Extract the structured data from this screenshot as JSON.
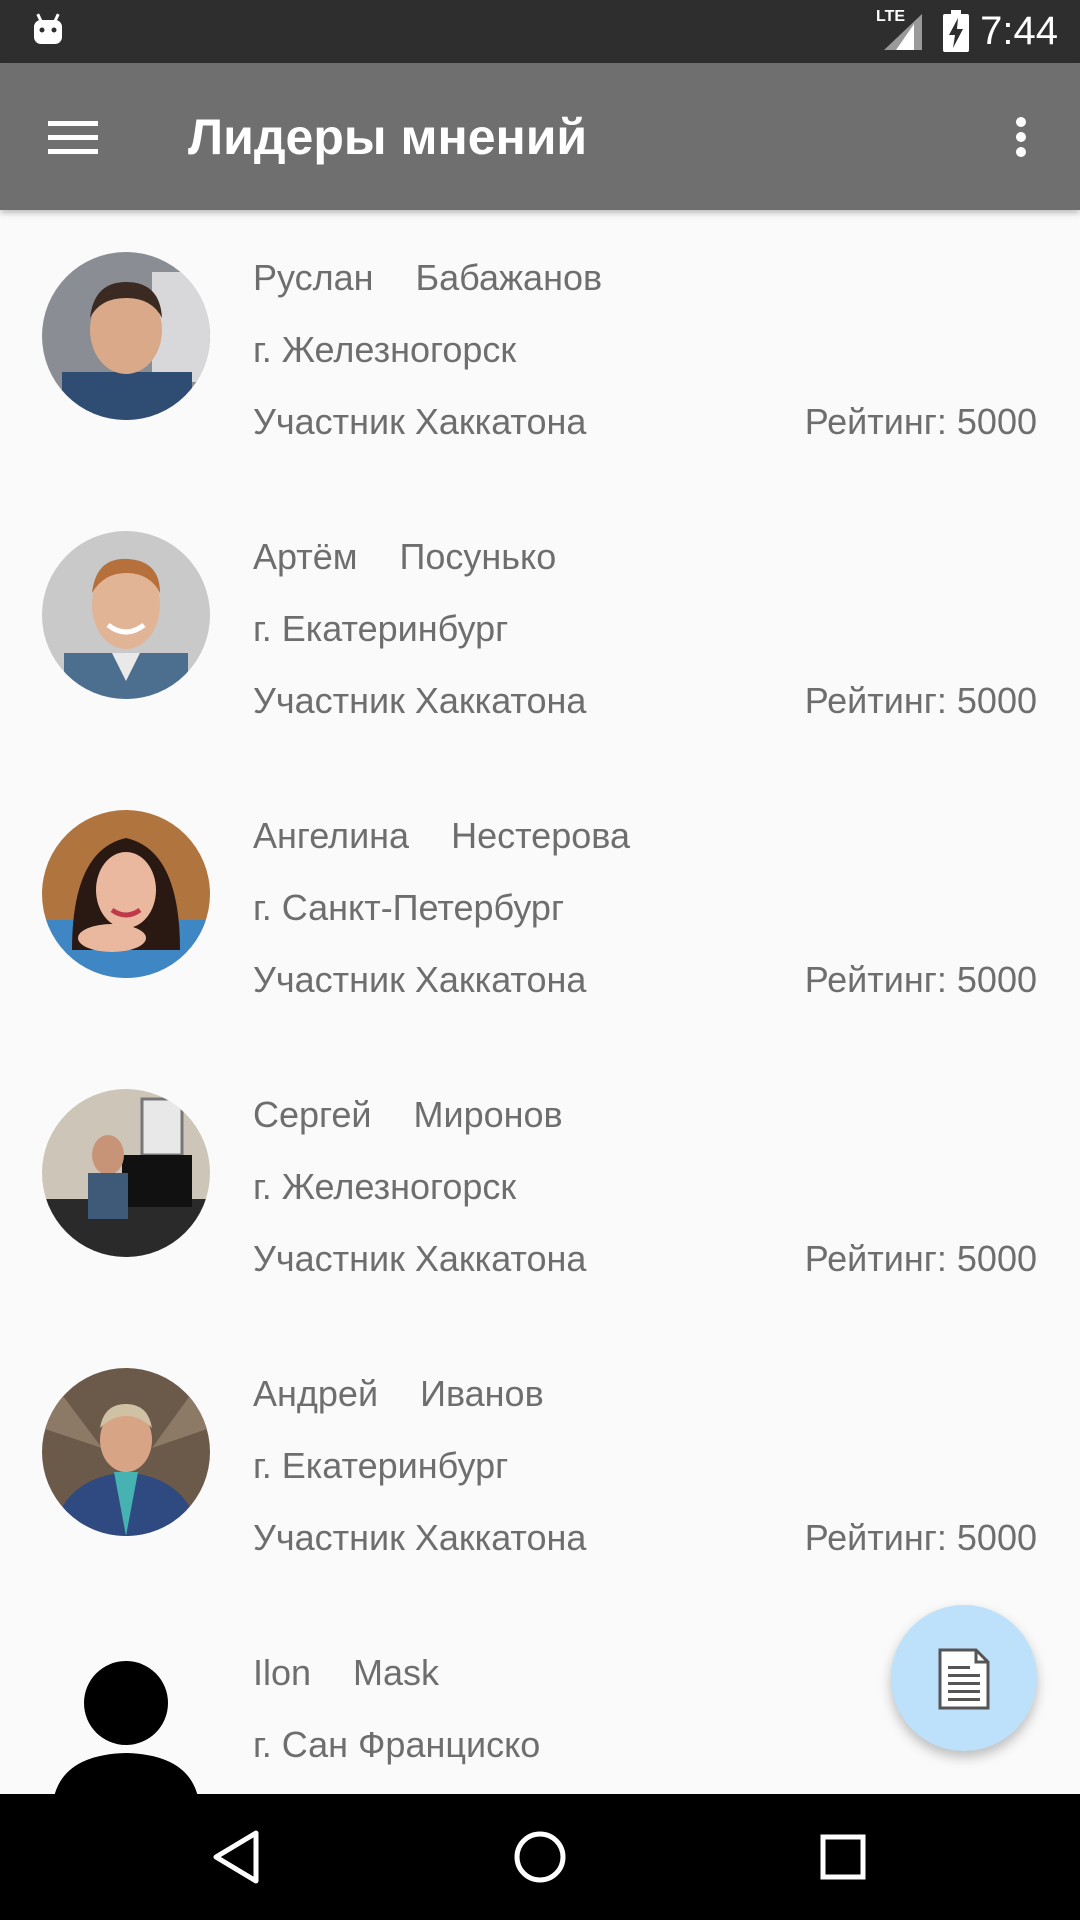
{
  "status_bar": {
    "network_label": "LTE",
    "time": "7:44"
  },
  "toolbar": {
    "title": "Лидеры мнений",
    "menu_icon": "hamburger-menu-icon",
    "more_icon": "more-vert-icon"
  },
  "leaders": [
    {
      "first_name": "Руслан",
      "last_name": "Бабажанов",
      "city": "г. Железногорск",
      "role": "Участник Хаккатона",
      "rating": "Рейтинг: 5000"
    },
    {
      "first_name": "Артём",
      "last_name": "Посунько",
      "city": "г. Екатеринбург",
      "role": "Участник Хаккатона",
      "rating": "Рейтинг: 5000"
    },
    {
      "first_name": "Ангелина",
      "last_name": "Нестерова",
      "city": "г. Санкт-Петербург",
      "role": "Участник Хаккатона",
      "rating": "Рейтинг: 5000"
    },
    {
      "first_name": "Сергей",
      "last_name": "Миронов",
      "city": "г. Железногорск",
      "role": "Участник Хаккатона",
      "rating": "Рейтинг: 5000"
    },
    {
      "first_name": "Андрей",
      "last_name": "Иванов",
      "city": "г. Екатеринбург",
      "role": "Участник Хаккатона",
      "rating": "Рейтинг: 5000"
    },
    {
      "first_name": "Ilon",
      "last_name": "Mask",
      "city": "г. Сан Франциско",
      "role": "",
      "rating": ""
    }
  ],
  "fab": {
    "icon": "document-icon",
    "color": "#bde0fb"
  },
  "colors": {
    "status_bar": "#2e2e2e",
    "toolbar": "#6f6f6f",
    "background": "#fafafa",
    "text": "#6e6e6e"
  }
}
